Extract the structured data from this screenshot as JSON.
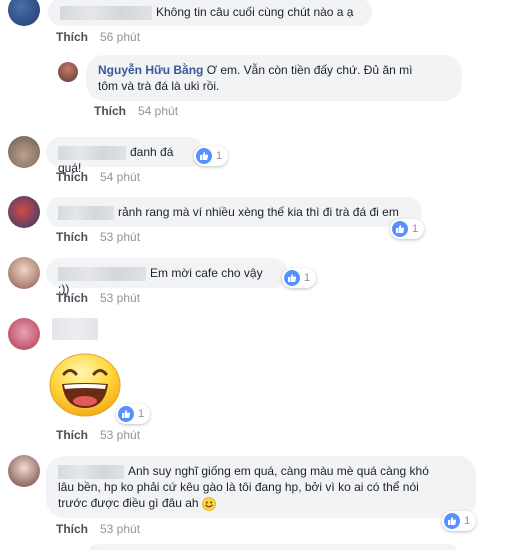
{
  "like_label": "Thích",
  "comments": [
    {
      "text": "Không tin câu cuối cùng chút nào a ạ",
      "time": "56 phút"
    },
    {
      "author": "Nguyễn Hữu Bằng",
      "text_line1": "Ơ em. Vẫn còn tiền đấy chứ. Đủ ăn mì",
      "text_line2": "tôm và trà đá là uki rồi.",
      "time": "54 phút"
    },
    {
      "text": "đanh đá quá!",
      "time": "54 phút",
      "reactions": "1"
    },
    {
      "text": "rảnh rang mà ví nhiều xèng thế kia thì đi trà đá đi em",
      "time": "53 phút",
      "reactions": "1"
    },
    {
      "text": "Em mời cafe cho vậy :))",
      "time": "53 phút",
      "reactions": "1"
    },
    {
      "time": "53 phút",
      "reactions": "1"
    },
    {
      "text_line1": "Anh suy nghĩ giống em quá, càng màu mè quá càng khó",
      "text_line2": "lâu bền, hp ko phải cứ kêu gào là tôi đang hp, bởi vì ko ai có thể nói",
      "text_line3": "trước được điều gì đâu ah",
      "time": "53 phút",
      "reactions": "1"
    }
  ],
  "colors": {
    "bubble": "#f2f3f5",
    "link": "#385898",
    "meta": "#90949c",
    "like_blue": "#5890ff"
  }
}
